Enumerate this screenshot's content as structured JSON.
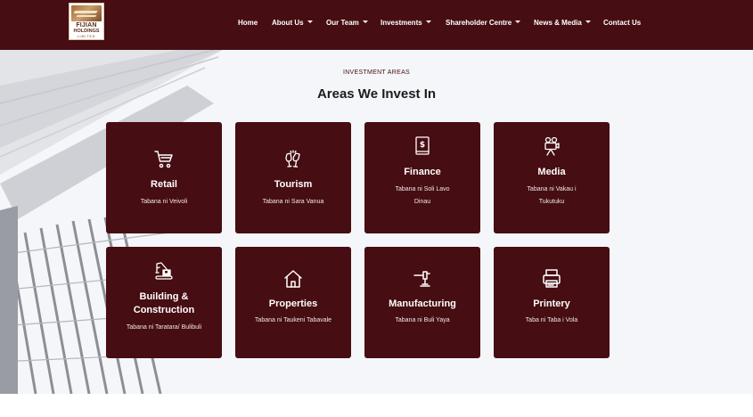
{
  "brand": {
    "logo_line1": "FIJIAN",
    "logo_line2": "HOLDINGS",
    "logo_line3": "LIMITED",
    "primary_color": "#460d12"
  },
  "nav": {
    "items": [
      {
        "label": "Home",
        "dropdown": false
      },
      {
        "label": "About Us",
        "dropdown": true
      },
      {
        "label": "Our Team",
        "dropdown": true
      },
      {
        "label": "Investments",
        "dropdown": true
      },
      {
        "label": "Shareholder Centre",
        "dropdown": true
      },
      {
        "label": "News & Media",
        "dropdown": true
      },
      {
        "label": "Contact Us",
        "dropdown": false
      }
    ]
  },
  "section": {
    "eyebrow": "INVESTMENT AREAS",
    "heading": "Areas We Invest In"
  },
  "cards": [
    {
      "icon": "shopping-cart-icon",
      "title": "Retail",
      "title2": "",
      "subtitle": "Tabana ni Veivoli",
      "subtitle2": ""
    },
    {
      "icon": "wine-glasses-icon",
      "title": "Tourism",
      "title2": "",
      "subtitle": "Tabana ni Sara Vanua",
      "subtitle2": ""
    },
    {
      "icon": "finance-book-icon",
      "title": "Finance",
      "title2": "",
      "subtitle": "Tabana ni Soli Lavo",
      "subtitle2": "Dinau"
    },
    {
      "icon": "movie-camera-icon",
      "title": "Media",
      "title2": "",
      "subtitle": "Tabana ni Vakau i",
      "subtitle2": "Tukutuku"
    },
    {
      "icon": "excavator-icon",
      "title": "Building &",
      "title2": "Construction",
      "subtitle": "Tabana ni Taratara/ Bulibuli",
      "subtitle2": ""
    },
    {
      "icon": "house-icon",
      "title": "Properties",
      "title2": "",
      "subtitle": "Tabana ni Taukeni Tabavale",
      "subtitle2": ""
    },
    {
      "icon": "hammer-icon",
      "title": "Manufacturing",
      "title2": "",
      "subtitle": "Tabana ni Buli Yaya",
      "subtitle2": ""
    },
    {
      "icon": "printer-icon",
      "title": "Printery",
      "title2": "",
      "subtitle": "Taba ni Taba i Vola",
      "subtitle2": ""
    }
  ]
}
